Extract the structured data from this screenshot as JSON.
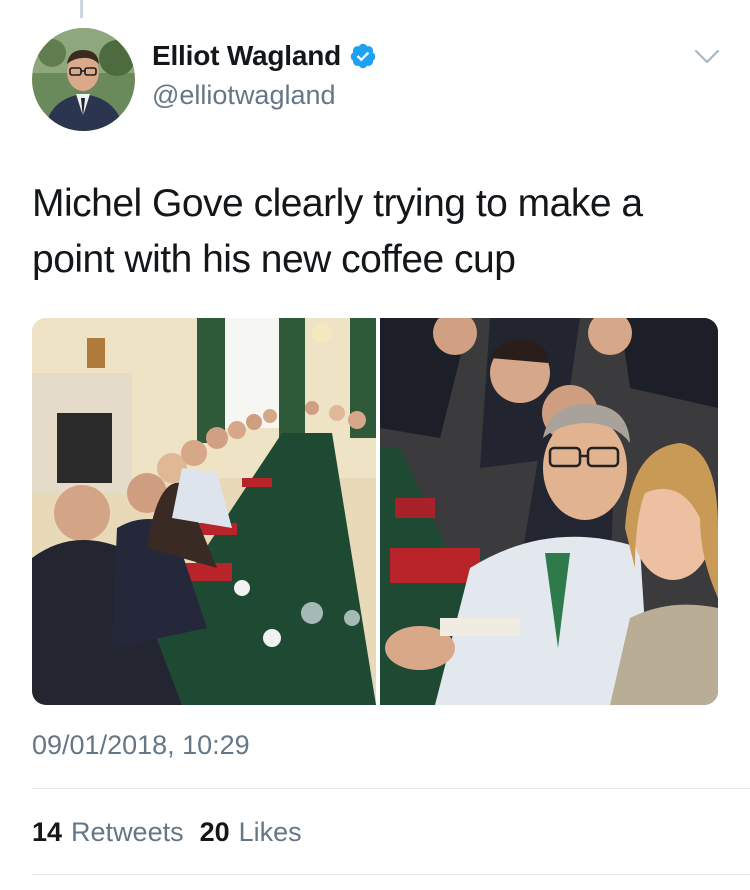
{
  "tweet": {
    "author": {
      "display_name": "Elliot Wagland",
      "handle": "@elliotwagland",
      "verified": true,
      "avatar_icon": "profile-photo"
    },
    "text": "Michel Gove clearly trying to make a point with his new coffee cup",
    "media": [
      {
        "alt_icon": "cabinet-meeting-photo-wide"
      },
      {
        "alt_icon": "cabinet-meeting-photo-closeup"
      }
    ],
    "timestamp": "09/01/2018, 10:29",
    "stats": {
      "retweets_count": "14",
      "retweets_label": "Retweets",
      "likes_count": "20",
      "likes_label": "Likes"
    }
  },
  "colors": {
    "primary_text": "#14171a",
    "secondary_text": "#657786",
    "divider": "#e1e8ed",
    "verified_blue": "#1da1f2"
  }
}
